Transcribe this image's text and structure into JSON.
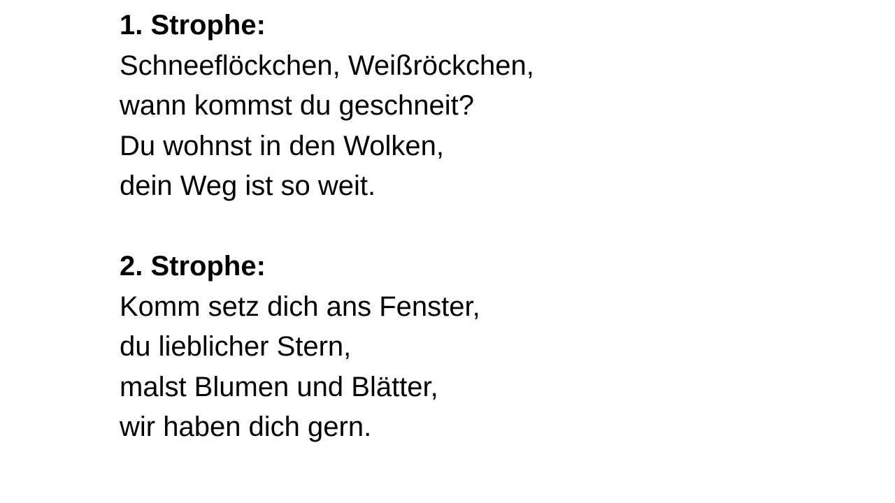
{
  "stanzas": [
    {
      "heading": "1. Strophe:",
      "lines": [
        "Schneeflöckchen, Weißröckchen,",
        "wann kommst du geschneit?",
        "Du wohnst in den Wolken,",
        "dein Weg ist so weit."
      ]
    },
    {
      "heading": "2. Strophe:",
      "lines": [
        "Komm setz dich ans Fenster,",
        "du lieblicher Stern,",
        "malst Blumen und Blätter,",
        "wir haben dich gern."
      ]
    }
  ]
}
